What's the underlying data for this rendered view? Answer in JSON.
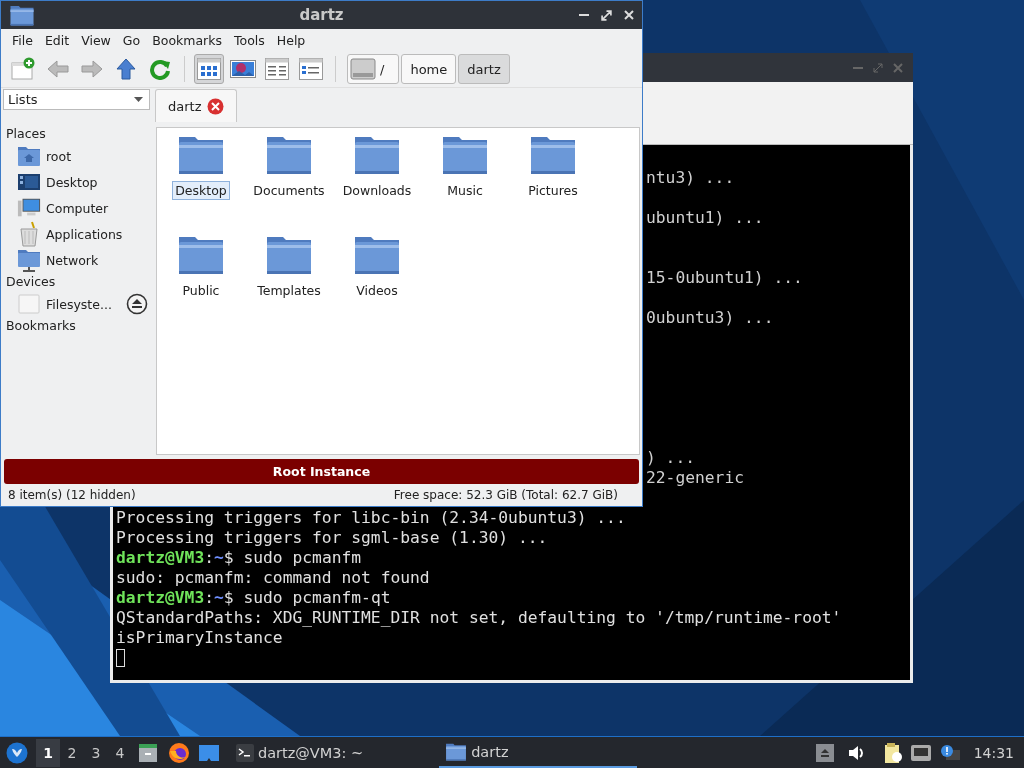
{
  "file_manager": {
    "title": "dartz",
    "menu": [
      "File",
      "Edit",
      "View",
      "Go",
      "Bookmarks",
      "Tools",
      "Help"
    ],
    "view_modes": [
      {
        "selected": true
      },
      {
        "selected": false
      },
      {
        "selected": false
      },
      {
        "selected": false
      }
    ],
    "path": [
      {
        "label": "/",
        "kind": "root",
        "selected": false
      },
      {
        "label": "home",
        "kind": "dir",
        "selected": false
      },
      {
        "label": "dartz",
        "kind": "dir",
        "selected": true
      }
    ],
    "side_pane": {
      "mode": "Lists",
      "sections": [
        {
          "title": "Places",
          "items": [
            {
              "label": "root",
              "kind": "home"
            },
            {
              "label": "Desktop",
              "kind": "desktop"
            },
            {
              "label": "Computer",
              "kind": "computer"
            },
            {
              "label": "Applications",
              "kind": "apps"
            },
            {
              "label": "Network",
              "kind": "network"
            }
          ]
        },
        {
          "title": "Devices",
          "items": [
            {
              "label": "Filesyste...",
              "kind": "drive"
            }
          ]
        },
        {
          "title": "Bookmarks"
        }
      ]
    },
    "tabs": [
      {
        "label": "dartz",
        "selected": true
      }
    ],
    "files": [
      {
        "name": "Desktop",
        "selected": true
      },
      {
        "name": "Documents",
        "selected": false
      },
      {
        "name": "Downloads",
        "selected": false
      },
      {
        "name": "Music",
        "selected": false
      },
      {
        "name": "Pictures",
        "selected": false
      },
      {
        "name": "Public",
        "selected": false
      },
      {
        "name": "Templates",
        "selected": false
      },
      {
        "name": "Videos",
        "selected": false
      }
    ],
    "banner": "Root Instance",
    "status": {
      "items": "8 item(s) (12 hidden)",
      "free_space": "Free space: 52.3 GiB (Total: 62.7 GiB)"
    }
  },
  "terminal": {
    "fragments": [
      "ntu3) ...",
      "ubuntu1) ...",
      "15-0ubuntu1) ...",
      "0ubuntu3) ...",
      ") ...",
      "22-generic"
    ],
    "lines": [
      {
        "segments": [
          {
            "kind": "text",
            "text": "Processing triggers for libc-bin (2.34-0ubuntu3) ..."
          }
        ]
      },
      {
        "segments": [
          {
            "kind": "text",
            "text": "Processing triggers for sgml-base (1.30) ..."
          }
        ]
      },
      {
        "segments": [
          {
            "kind": "user",
            "text": "dartz@VM3"
          },
          {
            "kind": "text",
            "text": ":"
          },
          {
            "kind": "path",
            "text": "~"
          },
          {
            "kind": "text",
            "text": "$ sudo pcmanfm"
          }
        ]
      },
      {
        "segments": [
          {
            "kind": "text",
            "text": "sudo: pcmanfm: command not found"
          }
        ]
      },
      {
        "segments": [
          {
            "kind": "user",
            "text": "dartz@VM3"
          },
          {
            "kind": "text",
            "text": ":"
          },
          {
            "kind": "path",
            "text": "~"
          },
          {
            "kind": "text",
            "text": "$ sudo pcmanfm-qt"
          }
        ]
      },
      {
        "segments": [
          {
            "kind": "text",
            "text": "QStandardPaths: XDG_RUNTIME_DIR not set, defaulting to '/tmp/runtime-root'"
          }
        ]
      },
      {
        "segments": [
          {
            "kind": "text",
            "text": "isPrimaryInstance"
          }
        ]
      }
    ]
  },
  "taskbar": {
    "desktops": [
      {
        "label": "1",
        "selected": true
      },
      {
        "label": "2",
        "selected": false
      },
      {
        "label": "3",
        "selected": false
      },
      {
        "label": "4",
        "selected": false
      }
    ],
    "tasks": [
      {
        "label": "dartz@VM3: ~",
        "kind": "terminal",
        "selected": false
      },
      {
        "label": "dartz",
        "kind": "folder",
        "selected": true
      }
    ],
    "clock": "14:31"
  }
}
